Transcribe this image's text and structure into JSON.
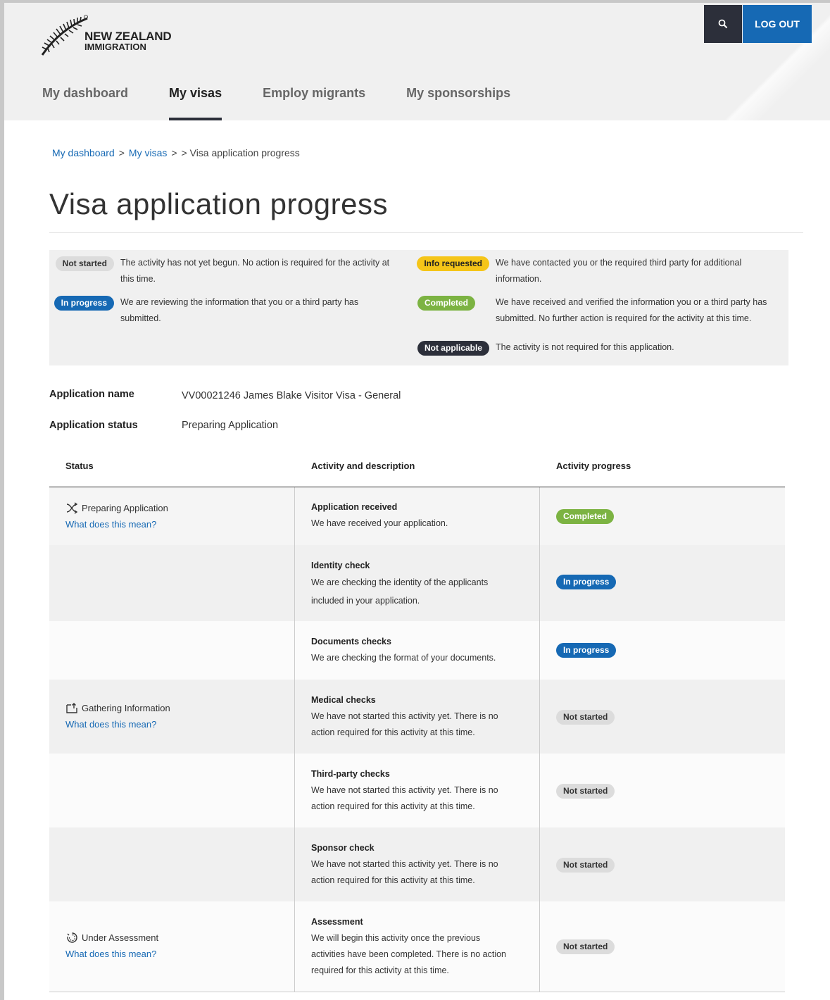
{
  "header": {
    "logo": {
      "line1": "NEW ZEALAND",
      "line2": "IMMIGRATION"
    },
    "search_icon": "search-icon",
    "logout_label": "LOG OUT",
    "nav": [
      {
        "label": "My dashboard",
        "active": false
      },
      {
        "label": "My visas",
        "active": true
      },
      {
        "label": "Employ migrants",
        "active": false
      },
      {
        "label": "My sponsorships",
        "active": false
      }
    ]
  },
  "breadcrumb": {
    "items": [
      "My dashboard",
      "My visas"
    ],
    "sep": ">",
    "current": "> Visa application progress"
  },
  "page_title": "Visa application progress",
  "legend": [
    {
      "badge": "Not started",
      "desc_line1": "The activity has not yet begun. No action is required for the activity at",
      "desc_line2": "this time."
    },
    {
      "badge": "Info requested",
      "desc_line1": "We have contacted you or the required third party for additional",
      "desc_line2": "information."
    },
    {
      "badge": "In progress",
      "desc_line1": "We are reviewing the information that you or a third party has",
      "desc_line2": "submitted."
    },
    {
      "badge": "Completed",
      "desc_line1": "We have received and verified the information you or a third party has",
      "desc_line2": "submitted. No further action is required for the activity at this time."
    },
    {
      "badge": "Not applicable",
      "desc_line1": "The activity is not required for this application.",
      "desc_line2": ""
    }
  ],
  "application": {
    "name_label": "Application name",
    "name_value": "VV00021246 James Blake Visitor Visa - General",
    "status_label": "Application status",
    "status_value": "Preparing Application"
  },
  "table": {
    "headers": {
      "status": "Status",
      "activity": "Activity and description",
      "progress": "Activity progress"
    },
    "link_text": "What does this mean?",
    "rows": [
      {
        "status": "Preparing Application",
        "status_icon": "shuffle-icon",
        "title": "Application received",
        "desc": [
          "We have received your application."
        ],
        "progress": "Completed"
      },
      {
        "status": "",
        "title": "Identity check",
        "desc": [
          "We are checking the identity of the applicants",
          "included in your application."
        ],
        "progress": "In progress"
      },
      {
        "status": "",
        "title": "Documents checks",
        "desc": [
          "We are checking the format of your documents."
        ],
        "progress": "In progress"
      },
      {
        "status": "Gathering Information",
        "status_icon": "folder-upload-icon",
        "title": "Medical checks",
        "desc": [
          "We have not started this activity yet. There is no",
          "action required for this activity at this time."
        ],
        "progress": "Not started"
      },
      {
        "status": "",
        "title": "Third-party checks",
        "desc": [
          "We have not started this activity yet. There is no",
          "action required for this activity at this time."
        ],
        "progress": "Not started"
      },
      {
        "status": "",
        "title": "Sponsor check",
        "desc": [
          "We have not started this activity yet. There is no",
          "action required for this activity at this time."
        ],
        "progress": "Not started"
      },
      {
        "status": "Under Assessment",
        "status_icon": "assessment-icon",
        "title": "Assessment",
        "desc": [
          "We will begin this activity once the previous",
          "activities have been completed. There is no action",
          "required for this activity at this time."
        ],
        "progress": "Not started"
      }
    ]
  }
}
